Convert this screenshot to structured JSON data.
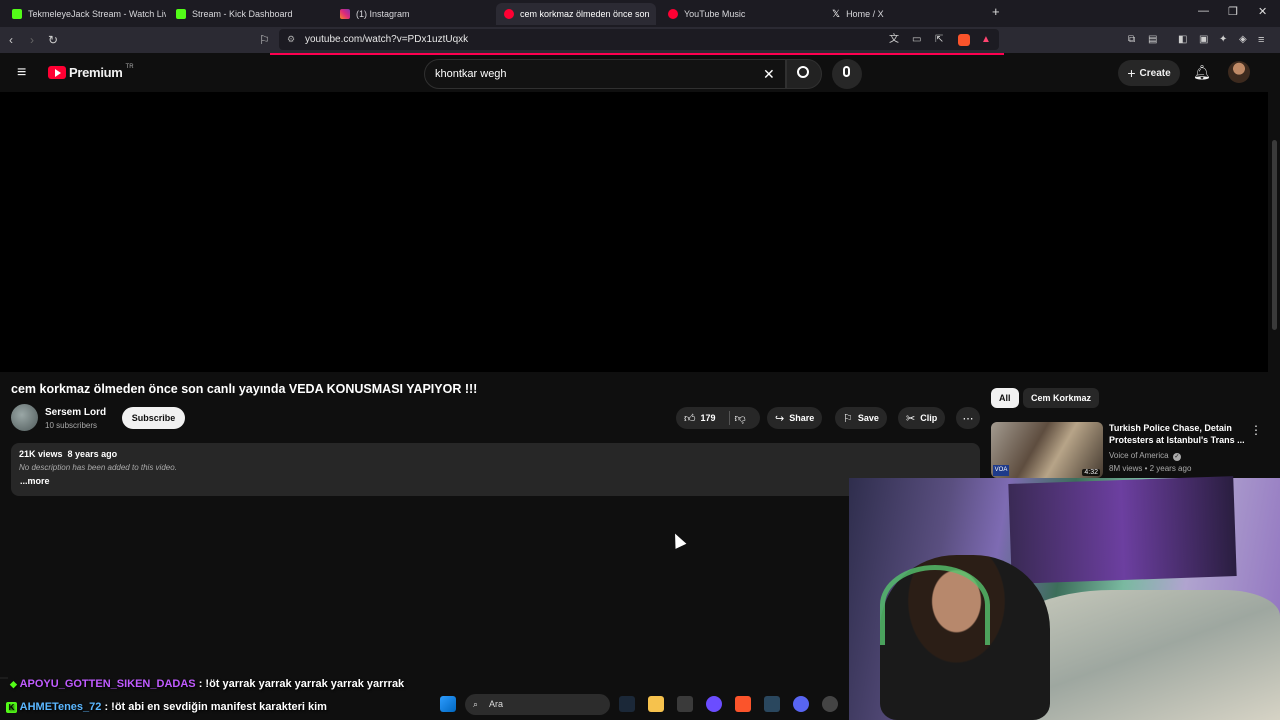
{
  "tabs": [
    {
      "label": "TekmeleyeJack Stream - Watch Live o",
      "color": "#53fc18"
    },
    {
      "label": "Stream - Kick Dashboard",
      "color": "#53fc18"
    },
    {
      "label": "(1) Instagram",
      "color": "#e1306c"
    },
    {
      "label": "cem korkmaz ölmeden önce son",
      "color": "#ff0033",
      "active": true
    },
    {
      "label": "YouTube Music",
      "color": "#ff0033"
    },
    {
      "label": "Home / X",
      "color": "#ffffff"
    }
  ],
  "address": {
    "url": "youtube.com/watch?v=PDx1uztUqxk"
  },
  "header": {
    "brand": "Premium",
    "region": "TR",
    "search_value": "khontkar wegh",
    "create_label": "Create"
  },
  "video": {
    "title": "cem korkmaz ölmeden önce son canlı yayında VEDA KONUSMASI YAPIYOR !!!",
    "channel": "Sersem Lord",
    "subscribers": "10 subscribers",
    "subscribe_label": "Subscribe",
    "likes": "179",
    "share_label": "Share",
    "save_label": "Save",
    "clip_label": "Clip",
    "views": "21K views",
    "age": "8 years ago",
    "description": "No description has been added to this video.",
    "more_label": "...more"
  },
  "chips": [
    "All",
    "Cem Korkmaz"
  ],
  "recommendation": {
    "title": "Turkish Police Chase, Detain Protesters at Istanbul's Trans ...",
    "channel": "Voice of America",
    "meta": "8M views • 2 years ago",
    "duration": "4:32"
  },
  "chat": [
    {
      "user": "APOYU_GOTTEN_SIKEN_DADAS",
      "message": ": !öt yarrak yarrak yarrak yarrak yarrrak"
    },
    {
      "user": "AHMETenes_72",
      "message": ": !öt abi en sevdiğin manifest karakteri kim"
    }
  ],
  "taskbar": {
    "search_label": "Ara"
  },
  "colors": {
    "youtube_red": "#ff0033",
    "kick_green": "#53fc18"
  }
}
